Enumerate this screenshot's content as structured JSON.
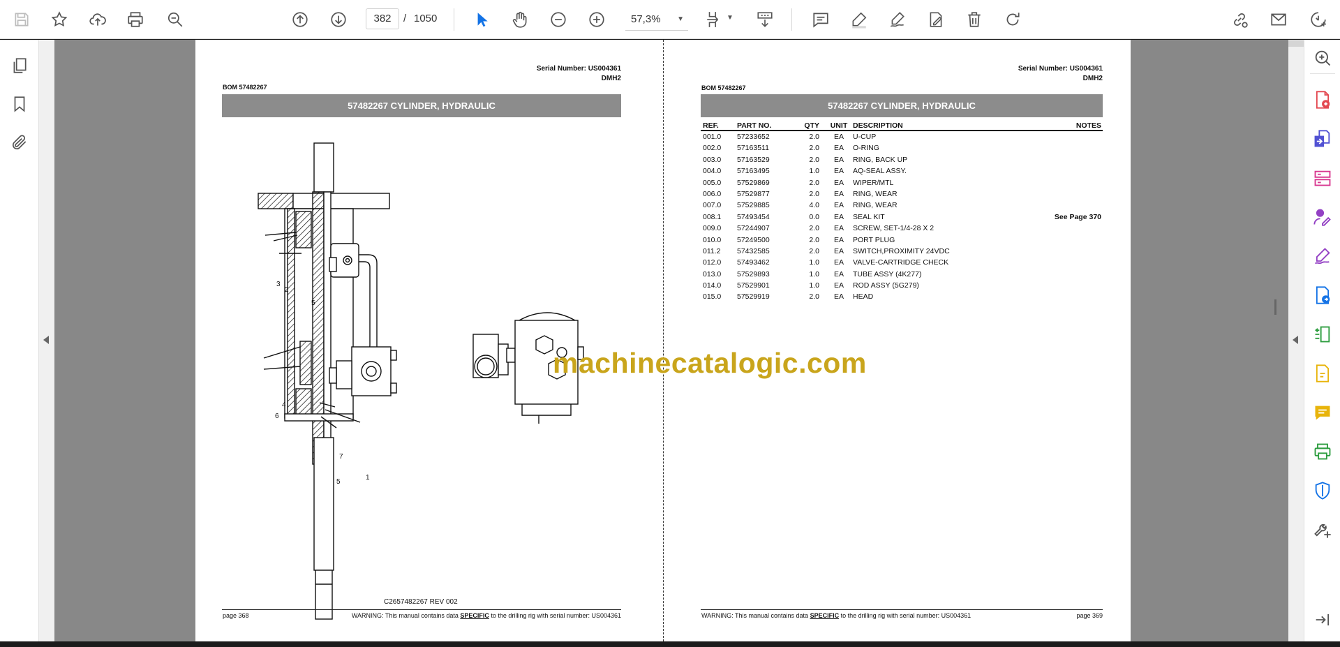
{
  "toolbar": {
    "current_page": "382",
    "page_separator": "/",
    "total_pages": "1050",
    "zoom": "57,3%"
  },
  "left_page": {
    "serial": "Serial Number: US004361",
    "model": "DMH2",
    "bom": "BOM 57482267",
    "title": "57482267 CYLINDER, HYDRAULIC",
    "drawing_caption": "C2657482267 REV 002",
    "page_label": "page 368",
    "warning_prefix": "WARNING:  This manual contains data ",
    "warning_emph": "SPECIFIC",
    "warning_suffix": " to the drilling rig with serial number: US004361",
    "callouts": [
      "3",
      "2",
      "5",
      "4",
      "6",
      "7",
      "5",
      "1"
    ]
  },
  "right_page": {
    "serial": "Serial Number: US004361",
    "model": "DMH2",
    "bom": "BOM 57482267",
    "title": "57482267 CYLINDER, HYDRAULIC",
    "page_label": "page 369",
    "warning_prefix": "WARNING:  This manual contains data ",
    "warning_emph": "SPECIFIC",
    "warning_suffix": " to the drilling rig with serial number: US004361",
    "table": {
      "headers": {
        "ref": "REF.",
        "part": "PART NO.",
        "qty": "QTY",
        "unit": "UNIT",
        "desc": "DESCRIPTION",
        "notes": "NOTES"
      },
      "rows": [
        {
          "ref": "001.0",
          "part": "57233652",
          "qty": "2.0",
          "unit": "EA",
          "desc": "U-CUP",
          "notes": ""
        },
        {
          "ref": "002.0",
          "part": "57163511",
          "qty": "2.0",
          "unit": "EA",
          "desc": "O-RING",
          "notes": ""
        },
        {
          "ref": "003.0",
          "part": "57163529",
          "qty": "2.0",
          "unit": "EA",
          "desc": "RING, BACK UP",
          "notes": ""
        },
        {
          "ref": "004.0",
          "part": "57163495",
          "qty": "1.0",
          "unit": "EA",
          "desc": "AQ-SEAL ASSY.",
          "notes": ""
        },
        {
          "ref": "005.0",
          "part": "57529869",
          "qty": "2.0",
          "unit": "EA",
          "desc": "WIPER/MTL",
          "notes": ""
        },
        {
          "ref": "006.0",
          "part": "57529877",
          "qty": "2.0",
          "unit": "EA",
          "desc": "RING, WEAR",
          "notes": ""
        },
        {
          "ref": "007.0",
          "part": "57529885",
          "qty": "4.0",
          "unit": "EA",
          "desc": "RING, WEAR",
          "notes": ""
        },
        {
          "ref": "008.1",
          "part": "57493454",
          "qty": "0.0",
          "unit": "EA",
          "desc": "SEAL KIT",
          "notes": "See Page 370"
        },
        {
          "ref": "009.0",
          "part": "57244907",
          "qty": "2.0",
          "unit": "EA",
          "desc": "SCREW, SET-1/4-28 X 2",
          "notes": ""
        },
        {
          "ref": "010.0",
          "part": "57249500",
          "qty": "2.0",
          "unit": "EA",
          "desc": "PORT PLUG",
          "notes": ""
        },
        {
          "ref": "011.2",
          "part": "57432585",
          "qty": "2.0",
          "unit": "EA",
          "desc": "SWITCH,PROXIMITY 24VDC",
          "notes": ""
        },
        {
          "ref": "012.0",
          "part": "57493462",
          "qty": "1.0",
          "unit": "EA",
          "desc": "VALVE-CARTRIDGE CHECK",
          "notes": ""
        },
        {
          "ref": "013.0",
          "part": "57529893",
          "qty": "1.0",
          "unit": "EA",
          "desc": "TUBE ASSY (4K277)",
          "notes": ""
        },
        {
          "ref": "014.0",
          "part": "57529901",
          "qty": "1.0",
          "unit": "EA",
          "desc": "ROD ASSY (5G279)",
          "notes": ""
        },
        {
          "ref": "015.0",
          "part": "57529919",
          "qty": "2.0",
          "unit": "EA",
          "desc": "HEAD",
          "notes": ""
        }
      ]
    }
  },
  "watermark": "machinecatalogic.com",
  "icons": {
    "toolbar": [
      "save-icon",
      "bookmark-star-icon",
      "upload-icon",
      "print-icon",
      "zoom-search-icon",
      "page-up-icon",
      "page-down-icon",
      "select-cursor-icon",
      "hand-pan-icon",
      "zoom-out-icon",
      "zoom-in-icon",
      "fit-page-icon",
      "scroll-mode-icon",
      "comment-icon",
      "highlight-pen-icon",
      "draw-signature-icon",
      "fill-sign-icon",
      "delete-icon",
      "rotate-icon",
      "share-link-icon",
      "email-icon",
      "account-add-icon"
    ],
    "left_rail": [
      "pages-thumbnail-icon",
      "bookmarks-icon",
      "attachments-icon"
    ],
    "right_rail": [
      "zoom-search-icon",
      "create-pdf-icon",
      "export-pdf-icon",
      "organize-pages-icon",
      "request-signatures-icon",
      "fill-sign-icon",
      "send-review-icon",
      "compress-icon",
      "comment-tool-icon",
      "stamp-comment-icon",
      "print-production-icon",
      "protect-icon",
      "more-tools-icon",
      "collapse-panel-icon"
    ]
  },
  "colors": {
    "watermark": "#c9a51c",
    "title_bar": "#8c8c8c",
    "accent_blue": "#1473e6"
  }
}
